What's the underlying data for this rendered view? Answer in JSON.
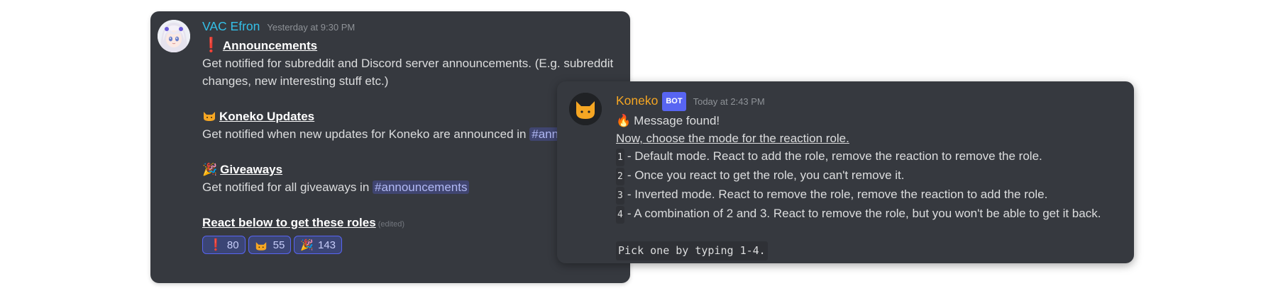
{
  "colors": {
    "background": "#ffffff",
    "card": "#36393f",
    "author_vac": "#34c0e8",
    "author_koneko": "#f5a623",
    "mention": "#b1b9f5",
    "bot_badge": "#5865f2"
  },
  "message1": {
    "author": "VAC Efron",
    "timestamp": "Yesterday at 9:30 PM",
    "sections": [
      {
        "icon": "exclamation-icon",
        "title": "Announcements",
        "text": "Get notified for subreddit and Discord server announcements. (E.g. subreddit changes, new interesting stuff etc.)"
      },
      {
        "icon": "cat-icon",
        "title": "Koneko Updates",
        "text": "Get notified when new updates for Koneko are announced in",
        "mention": "#announcements"
      },
      {
        "icon": "party-popper-icon",
        "title": "Giveaways",
        "text": "Get notified for all giveaways in",
        "mention": "#announcements"
      }
    ],
    "footer": "React below to get these roles",
    "edited": "(edited)",
    "reactions": [
      {
        "icon": "exclamation-icon",
        "count": "80"
      },
      {
        "icon": "cat-icon",
        "count": "55"
      },
      {
        "icon": "party-popper-icon",
        "count": "143"
      }
    ]
  },
  "message2": {
    "author": "Koneko",
    "badge": "BOT",
    "timestamp": "Today at 2:43 PM",
    "found": "Message found!",
    "prompt": "Now, choose the mode for the reaction role.",
    "options": [
      {
        "num": "1",
        "text": "- Default mode. React to add the role, remove the reaction to remove the role."
      },
      {
        "num": "2",
        "text": "- Once you react to get the role, you can't remove it."
      },
      {
        "num": "3",
        "text": "- Inverted mode. React to remove the role, remove the reaction to add the role."
      },
      {
        "num": "4",
        "text": "- A combination of 2 and 3. React to remove the role, but you won't be able to get it back."
      }
    ],
    "code": "Pick one by typing 1-4."
  }
}
